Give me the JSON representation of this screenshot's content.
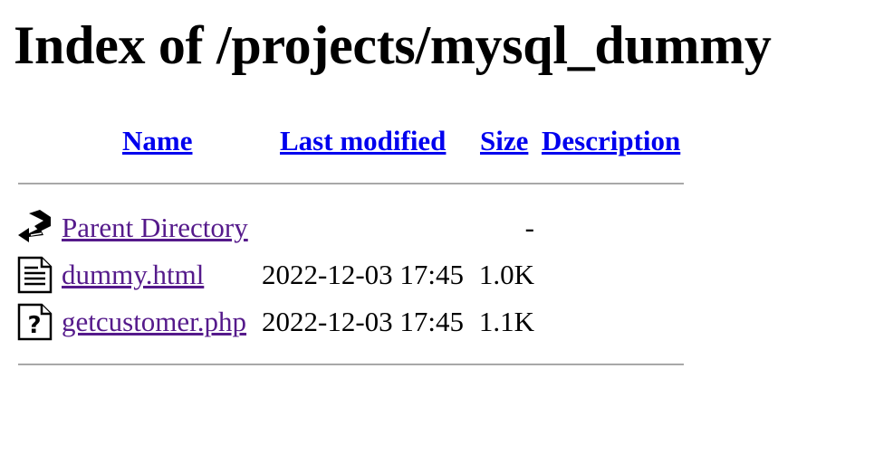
{
  "page": {
    "title": "Index of /projects/mysql_dummy"
  },
  "table": {
    "headers": {
      "name": "Name",
      "last_modified": "Last modified",
      "size": "Size",
      "description": "Description"
    },
    "rows": [
      {
        "icon": "back-arrow-icon",
        "name": "Parent Directory",
        "last_modified": "",
        "size": "-",
        "description": ""
      },
      {
        "icon": "text-file-icon",
        "name": "dummy.html",
        "last_modified": "2022-12-03 17:45",
        "size": "1.0K",
        "description": ""
      },
      {
        "icon": "unknown-file-icon",
        "name": "getcustomer.php",
        "last_modified": "2022-12-03 17:45",
        "size": "1.1K",
        "description": ""
      }
    ]
  }
}
